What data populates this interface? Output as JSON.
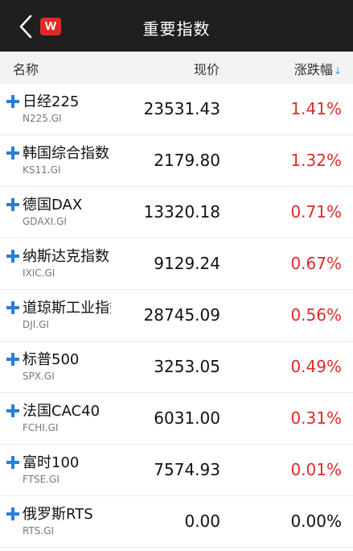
{
  "header": {
    "title": "重要指数",
    "logo_text": "W"
  },
  "columns": {
    "name": "名称",
    "price": "现价",
    "change": "涨跌幅",
    "sort_indicator": "↓"
  },
  "colors": {
    "up": "#e02a2a",
    "flat": "#111111",
    "accent": "#2a7ed8"
  },
  "rows": [
    {
      "name": "日经225",
      "code": "N225.GI",
      "price": "23531.43",
      "change": "1.41%",
      "direction": "up"
    },
    {
      "name": "韩国综合指数",
      "code": "KS11.GI",
      "price": "2179.80",
      "change": "1.32%",
      "direction": "up"
    },
    {
      "name": "德国DAX",
      "code": "GDAXI.GI",
      "price": "13320.18",
      "change": "0.71%",
      "direction": "up"
    },
    {
      "name": "纳斯达克指数",
      "code": "IXIC.GI",
      "price": "9129.24",
      "change": "0.67%",
      "direction": "up"
    },
    {
      "name": "道琼斯工业指数",
      "code": "DJI.GI",
      "price": "28745.09",
      "change": "0.56%",
      "direction": "up"
    },
    {
      "name": "标普500",
      "code": "SPX.GI",
      "price": "3253.05",
      "change": "0.49%",
      "direction": "up"
    },
    {
      "name": "法国CAC40",
      "code": "FCHI.GI",
      "price": "6031.00",
      "change": "0.31%",
      "direction": "up"
    },
    {
      "name": "富时100",
      "code": "FTSE.GI",
      "price": "7574.93",
      "change": "0.01%",
      "direction": "up"
    },
    {
      "name": "俄罗斯RTS",
      "code": "RTS.GI",
      "price": "0.00",
      "change": "0.00%",
      "direction": "flat"
    }
  ]
}
